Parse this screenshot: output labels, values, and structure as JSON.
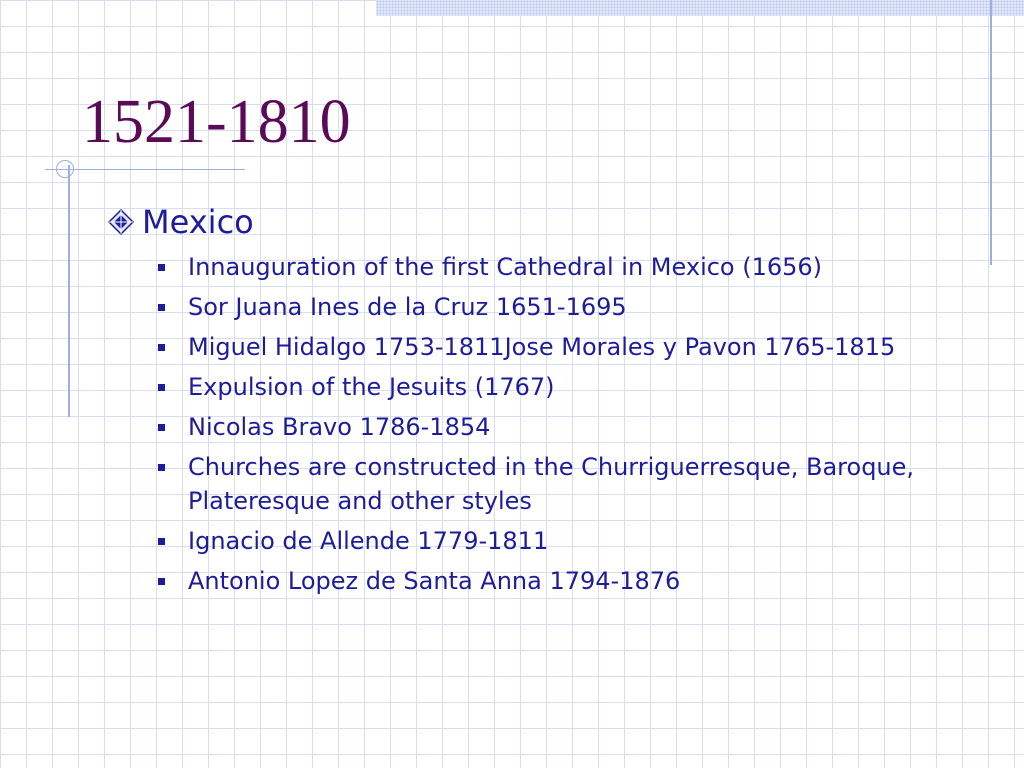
{
  "slide": {
    "title": "1521-1810",
    "level1": "Mexico",
    "items": [
      "Innauguration of the first Cathedral in Mexico (1656)",
      "Sor Juana Ines de la Cruz 1651-1695",
      "Miguel Hidalgo 1753-1811Jose Morales y Pavon 1765-1815",
      "Expulsion of the Jesuits (1767)",
      "Nicolas Bravo 1786-1854",
      "Churches are constructed in the Churriguerresque, Baroque, Plateresque and other styles",
      "Ignacio de Allende 1779-1811",
      "Antonio Lopez de Santa Anna 1794-1876"
    ]
  },
  "colors": {
    "title": "#5a0a57",
    "body_text": "#1d1d9b",
    "accent_lines": "#9bb0e0",
    "grid": "#d8def0"
  },
  "icons": {
    "level1_bullet": "diamond-bullet-icon",
    "level2_bullet": "square-bullet-icon"
  }
}
